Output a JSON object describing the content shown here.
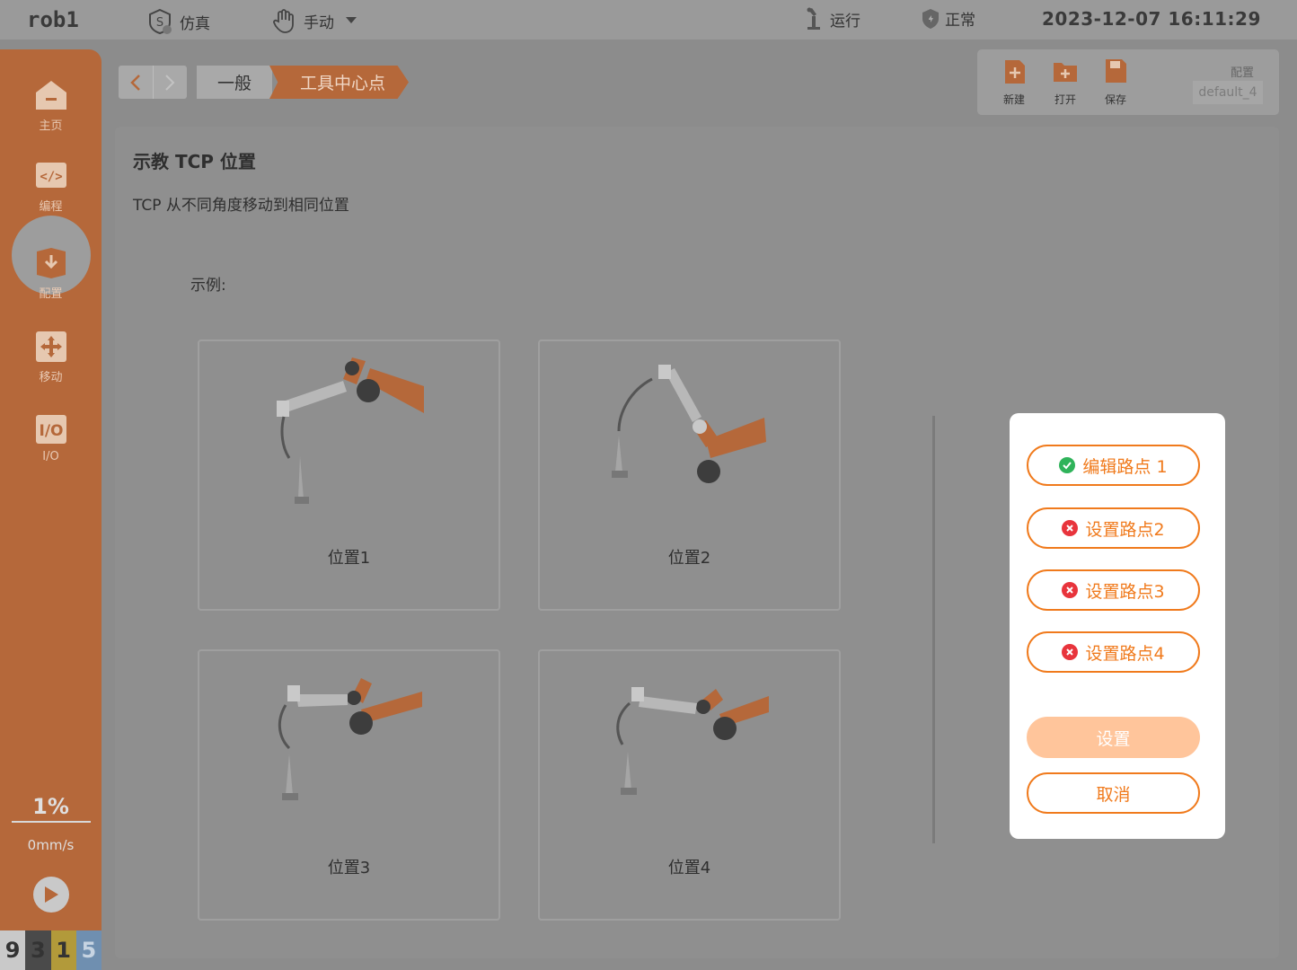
{
  "topbar": {
    "robot_name": "rob1",
    "mode_sim": "仿真",
    "mode_manual": "手动",
    "run_state": "运行",
    "safety_state": "正常",
    "datetime": "2023-12-07 16:11:29"
  },
  "sidebar": {
    "items": [
      {
        "label": "主页",
        "icon": "home-icon"
      },
      {
        "label": "编程",
        "icon": "code-icon"
      },
      {
        "label": "配置",
        "icon": "config-icon"
      },
      {
        "label": "移动",
        "icon": "move-icon"
      },
      {
        "label": "I/O",
        "icon": "io-icon"
      }
    ],
    "active_index": 2,
    "speed_percent": "1%",
    "speed_mm": "0mm/s",
    "counters": [
      {
        "value": "9",
        "color": "#c9c9c9"
      },
      {
        "value": "3",
        "color": "#4a4a4a"
      },
      {
        "value": "1",
        "color": "#b29a3a"
      },
      {
        "value": "5",
        "color": "#6f8fb0"
      }
    ]
  },
  "breadcrumb": {
    "general": "一般",
    "current": "工具中心点"
  },
  "file_panel": {
    "new_label": "新建",
    "open_label": "打开",
    "save_label": "保存",
    "config_label": "配置",
    "config_name": "default_4"
  },
  "content": {
    "title": "示教 TCP 位置",
    "subtitle": "TCP 从不同角度移动到相同位置",
    "example_label": "示例:",
    "positions": [
      "位置1",
      "位置2",
      "位置3",
      "位置4"
    ]
  },
  "popup": {
    "waypoints": [
      {
        "label": "编辑路点 1",
        "status": "done"
      },
      {
        "label": "设置路点2",
        "status": "error"
      },
      {
        "label": "设置路点3",
        "status": "error"
      },
      {
        "label": "设置路点4",
        "status": "error"
      }
    ],
    "set_label": "设置",
    "cancel_label": "取消",
    "colors": {
      "accent": "#f07a1c",
      "ok": "#2fb35a",
      "error": "#e8343c",
      "disabled": "#ffc59b"
    }
  }
}
